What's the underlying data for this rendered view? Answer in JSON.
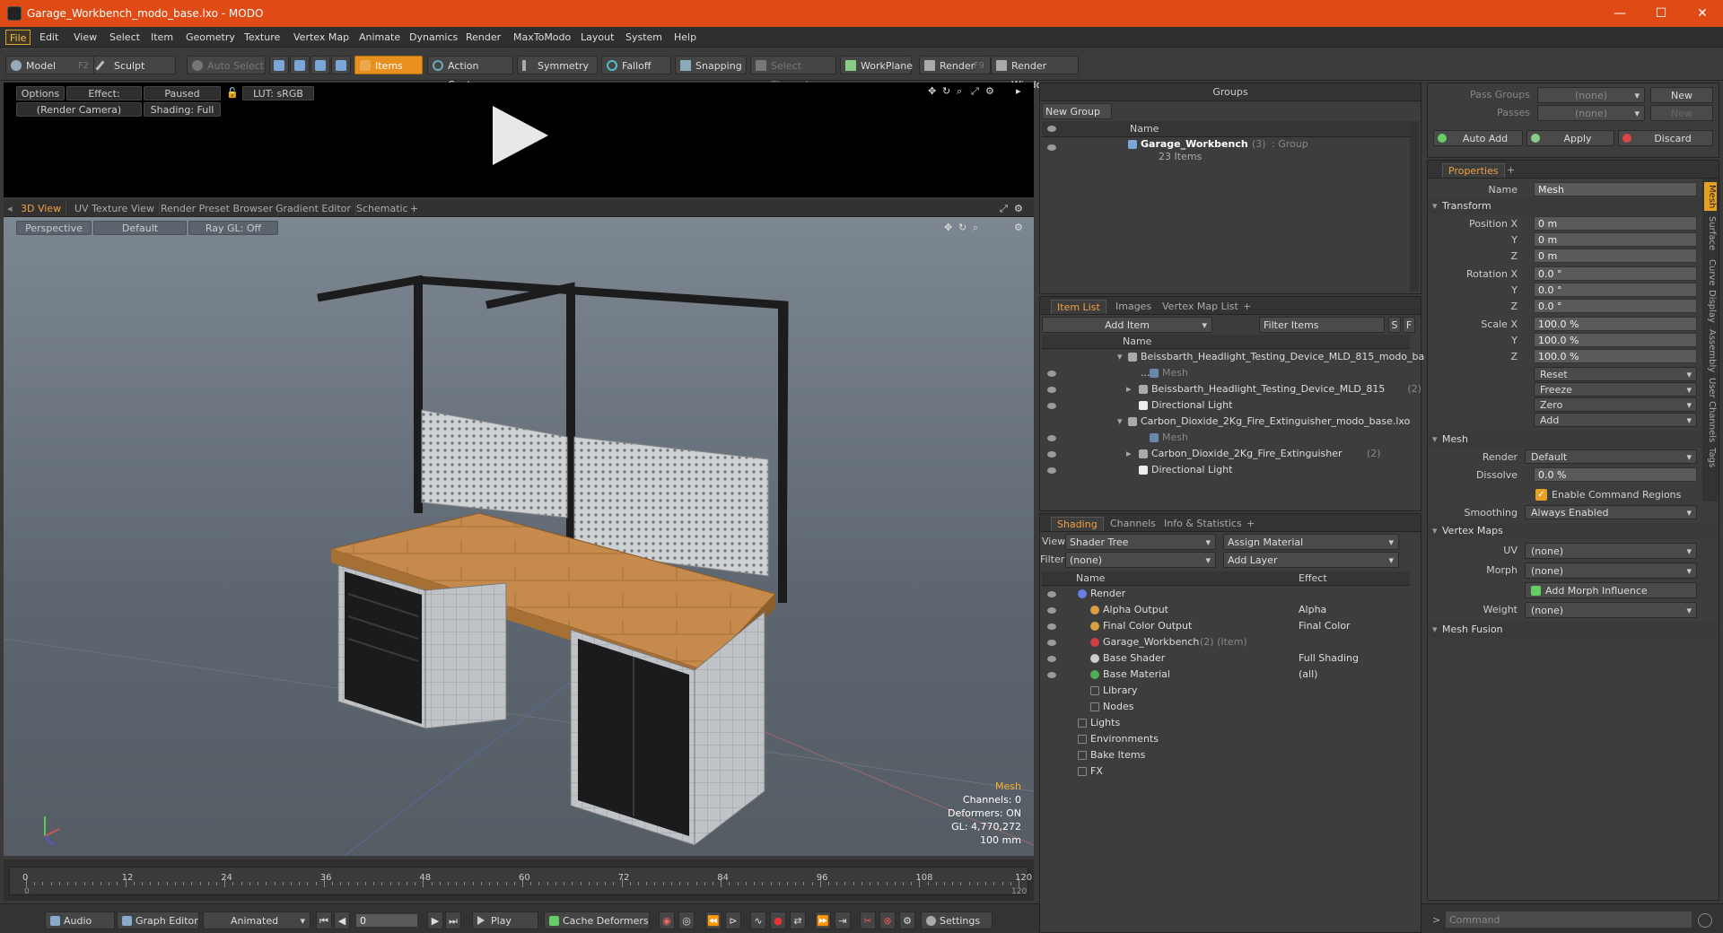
{
  "window": {
    "title": "Garage_Workbench_modo_base.lxo - MODO"
  },
  "menu": [
    "File",
    "Edit",
    "View",
    "Select",
    "Item",
    "Geometry",
    "Texture",
    "Vertex Map",
    "Animate",
    "Dynamics",
    "Render",
    "MaxToModo",
    "Layout",
    "System",
    "Help"
  ],
  "toolbar": {
    "model": "Model",
    "model_key": "F2",
    "sculpt": "Sculpt",
    "auto_select": "Auto Select",
    "items": "Items",
    "action_center": "Action Center",
    "symmetry": "Symmetry",
    "falloff": "Falloff",
    "snapping": "Snapping",
    "select_through": "Select Through",
    "workplane": "WorkPlane",
    "render": "Render",
    "render_key": "F9",
    "render_window": "Render Window"
  },
  "preview": {
    "options": "Options",
    "effect": "Effect: (Shadi...",
    "paused": "Paused",
    "lut": "LUT: sRGB",
    "camera": "(Render Camera)",
    "shading": "Shading: Full"
  },
  "viewport_tabs": [
    "3D View",
    "UV Texture View",
    "Render Preset Browser",
    "Gradient Editor",
    "Schematic"
  ],
  "viewport": {
    "projection": "Perspective",
    "style": "Default",
    "raygl": "Ray GL: Off",
    "info": {
      "type": "Mesh",
      "channels": "Channels: 0",
      "deformers": "Deformers: ON",
      "gl": "GL: 4,770,272",
      "scale": "100 mm"
    }
  },
  "timeline": {
    "labels": [
      "0",
      "12",
      "24",
      "36",
      "48",
      "60",
      "72",
      "84",
      "96",
      "108",
      "120"
    ],
    "start": "0",
    "end": "120"
  },
  "bottombar": {
    "audio": "Audio",
    "graph_editor": "Graph Editor",
    "animated": "Animated",
    "frame": "0",
    "play": "Play",
    "cache": "Cache Deformers",
    "settings": "Settings"
  },
  "groups": {
    "title": "Groups",
    "new_group": "New Group",
    "col_name": "Name",
    "group_name": "Garage_Workbench",
    "group_count": "(3)",
    "group_type": ": Group",
    "group_items": "23 Items"
  },
  "itemlist": {
    "tabs": [
      "Item List",
      "Images",
      "Vertex Map List"
    ],
    "add_item": "Add Item",
    "filter": "Filter Items",
    "col_name": "Name",
    "rows": [
      {
        "name": "Beissbarth_Headlight_Testing_Device_MLD_815_modo_ba ...",
        "indent": 0
      },
      {
        "name": "Mesh",
        "indent": 2,
        "dim": true
      },
      {
        "name": "Beissbarth_Headlight_Testing_Device_MLD_815",
        "suffix": "(2)",
        "indent": 1
      },
      {
        "name": "Directional Light",
        "indent": 1
      },
      {
        "name": "Carbon_Dioxide_2Kg_Fire_Extinguisher_modo_base.lxo",
        "indent": 0
      },
      {
        "name": "Mesh",
        "indent": 2,
        "dim": true
      },
      {
        "name": "Carbon_Dioxide_2Kg_Fire_Extinguisher",
        "suffix": "(2)",
        "indent": 1
      },
      {
        "name": "Directional Light",
        "indent": 1
      }
    ]
  },
  "shading": {
    "tabs": [
      "Shading",
      "Channels",
      "Info & Statistics"
    ],
    "view_label": "View",
    "view_value": "Shader Tree",
    "assign": "Assign Material",
    "filter_label": "Filter",
    "filter_value": "(none)",
    "add_layer": "Add Layer",
    "col_name": "Name",
    "col_effect": "Effect",
    "rows": [
      {
        "name": "Render",
        "effect": "",
        "indent": 0,
        "color": "#6a7de0"
      },
      {
        "name": "Alpha Output",
        "effect": "Alpha",
        "indent": 1,
        "color": "#d8a040"
      },
      {
        "name": "Final Color Output",
        "effect": "Final Color",
        "indent": 1,
        "color": "#d8a040"
      },
      {
        "name": "Garage_Workbench",
        "suffix": "(2) (Item)",
        "effect": "",
        "indent": 1,
        "color": "#d04040"
      },
      {
        "name": "Base Shader",
        "effect": "Full Shading",
        "indent": 1,
        "color": "#cccccc"
      },
      {
        "name": "Base Material",
        "effect": "(all)",
        "indent": 1,
        "color": "#50b050"
      },
      {
        "name": "Library",
        "effect": "",
        "indent": 1,
        "color": ""
      },
      {
        "name": "Nodes",
        "effect": "",
        "indent": 1,
        "color": ""
      },
      {
        "name": "Lights",
        "effect": "",
        "indent": 0,
        "color": ""
      },
      {
        "name": "Environments",
        "effect": "",
        "indent": 0,
        "color": ""
      },
      {
        "name": "Bake Items",
        "effect": "",
        "indent": 0,
        "color": ""
      },
      {
        "name": "FX",
        "effect": "",
        "indent": 0,
        "color": ""
      }
    ]
  },
  "passes": {
    "pass_groups": "Pass Groups",
    "passes": "Passes",
    "none": "(none)",
    "new": "New",
    "auto_add": "Auto Add",
    "apply": "Apply",
    "discard": "Discard"
  },
  "properties": {
    "tab": "Properties",
    "name_label": "Name",
    "name_value": "Mesh",
    "transform": "Transform",
    "pos_label": "Position X",
    "rot_label": "Rotation X",
    "scale_label": "Scale X",
    "y": "Y",
    "z": "Z",
    "pos": [
      "0 m",
      "0 m",
      "0 m"
    ],
    "rot": [
      "0.0 °",
      "0.0 °",
      "0.0 °"
    ],
    "scale": [
      "100.0 %",
      "100.0 %",
      "100.0 %"
    ],
    "actions": [
      "Reset",
      "Freeze",
      "Zero",
      "Add"
    ],
    "mesh": "Mesh",
    "render_label": "Render",
    "render_value": "Default",
    "dissolve_label": "Dissolve",
    "dissolve_value": "0.0 %",
    "ecr": "Enable Command Regions",
    "smoothing_label": "Smoothing",
    "smoothing_value": "Always Enabled",
    "vertex_maps": "Vertex Maps",
    "uv_label": "UV",
    "uv_value": "(none)",
    "morph_label": "Morph",
    "morph_value": "(none)",
    "add_morph": "Add Morph Influence",
    "weight_label": "Weight",
    "weight_value": "(none)",
    "mesh_fusion": "Mesh Fusion",
    "side_tabs": [
      "Mesh",
      "Surface",
      "Curve",
      "Display",
      "Assembly",
      "User Channels",
      "Tags"
    ]
  },
  "command": {
    "placeholder": "Command"
  }
}
